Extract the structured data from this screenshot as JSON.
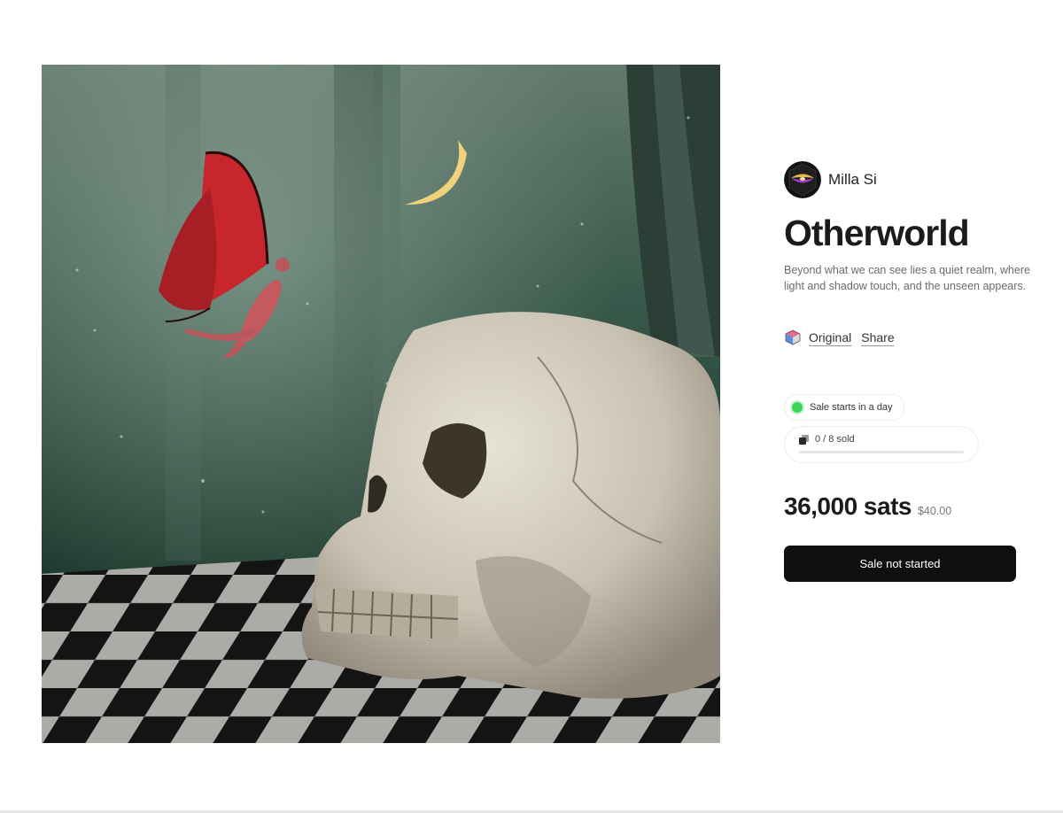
{
  "artwork": {
    "image": "forest-skull-fairy-artwork"
  },
  "artist": {
    "name": "Milla Si",
    "avatar": "hexagon-lips-avatar"
  },
  "title": "Otherworld",
  "description": "Beyond what we can see lies a quiet realm, where light and shadow touch, and the unseen appears.",
  "links": {
    "original_icon": "cube-icon",
    "original": "Original",
    "share": "Share"
  },
  "sale": {
    "status": "Sale starts in a day",
    "status_color": "#39d65a",
    "sold_text": "0 / 8 sold",
    "sold": 0,
    "edition_size": 8
  },
  "price": {
    "amount": "36,000 sats",
    "usd": "$40.00"
  },
  "cta": {
    "label": "Sale not started"
  }
}
